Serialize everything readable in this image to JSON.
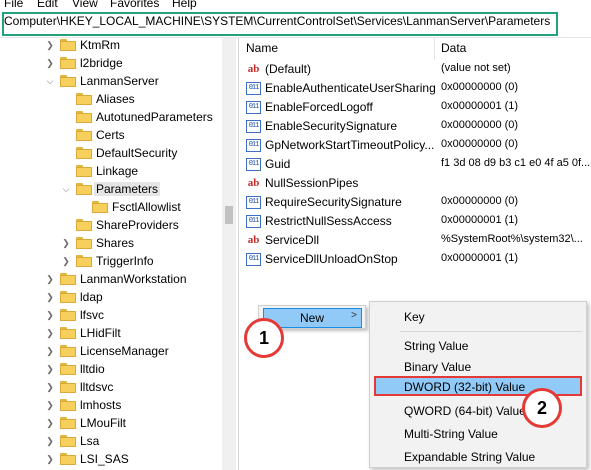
{
  "menubar": [
    "File",
    "Edit",
    "View",
    "Favorites",
    "Help"
  ],
  "address": "Computer\\HKEY_LOCAL_MACHINE\\SYSTEM\\CurrentControlSet\\Services\\LanmanServer\\Parameters",
  "accent": "#26a07a",
  "tree": [
    {
      "label": "KtmRm",
      "chevron": ">"
    },
    {
      "label": "l2bridge",
      "chevron": ">"
    },
    {
      "label": "LanmanServer",
      "chevron": "v"
    },
    {
      "label": "Aliases",
      "chevron": ""
    },
    {
      "label": "AutotunedParameters",
      "chevron": ""
    },
    {
      "label": "Certs",
      "chevron": ""
    },
    {
      "label": "DefaultSecurity",
      "chevron": ""
    },
    {
      "label": "Linkage",
      "chevron": ""
    },
    {
      "label": "Parameters",
      "chevron": "v",
      "selected": true
    },
    {
      "label": "FsctlAllowlist",
      "chevron": ""
    },
    {
      "label": "ShareProviders",
      "chevron": ""
    },
    {
      "label": "Shares",
      "chevron": ">"
    },
    {
      "label": "TriggerInfo",
      "chevron": ">"
    },
    {
      "label": "LanmanWorkstation",
      "chevron": ">"
    },
    {
      "label": "ldap",
      "chevron": ">"
    },
    {
      "label": "lfsvc",
      "chevron": ">"
    },
    {
      "label": "LHidFilt",
      "chevron": ">"
    },
    {
      "label": "LicenseManager",
      "chevron": ">"
    },
    {
      "label": "lltdio",
      "chevron": ">"
    },
    {
      "label": "lltdsvc",
      "chevron": ">"
    },
    {
      "label": "lmhosts",
      "chevron": ">"
    },
    {
      "label": "LMouFilt",
      "chevron": ">"
    },
    {
      "label": "Lsa",
      "chevron": ">"
    },
    {
      "label": "LSI_SAS",
      "chevron": ">"
    }
  ],
  "columns": {
    "name": "Name",
    "data": "Data"
  },
  "values": [
    {
      "icon": "ab",
      "name": "(Default)",
      "data": "(value not set)"
    },
    {
      "icon": "bin",
      "name": "EnableAuthenticateUserSharing",
      "data": "0x00000000 (0)"
    },
    {
      "icon": "bin",
      "name": "EnableForcedLogoff",
      "data": "0x00000001 (1)"
    },
    {
      "icon": "bin",
      "name": "EnableSecuritySignature",
      "data": "0x00000000 (0)"
    },
    {
      "icon": "bin",
      "name": "GpNetworkStartTimeoutPolicy...",
      "data": "0x00000000 (0)"
    },
    {
      "icon": "bin",
      "name": "Guid",
      "data": "f1 3d 08 d9 b3 c1 e0 4f a5 0f..."
    },
    {
      "icon": "ab",
      "name": "NullSessionPipes",
      "data": ""
    },
    {
      "icon": "bin",
      "name": "RequireSecuritySignature",
      "data": "0x00000000 (0)"
    },
    {
      "icon": "bin",
      "name": "RestrictNullSessAccess",
      "data": "0x00000001 (1)"
    },
    {
      "icon": "ab",
      "name": "ServiceDll",
      "data": "%SystemRoot%\\system32\\..."
    },
    {
      "icon": "bin",
      "name": "ServiceDllUnloadOnStop",
      "data": "0x00000001 (1)"
    }
  ],
  "context_menu": {
    "new_label": "New",
    "arrow": ">"
  },
  "submenu": {
    "key": "Key",
    "string": "String Value",
    "binary": "Binary Value",
    "dword": "DWORD (32-bit) Value",
    "qword": "QWORD (64-bit) Value",
    "multi": "Multi-String Value",
    "expand": "Expandable String Value"
  },
  "badges": {
    "one": "1",
    "two": "2"
  },
  "highlight_color": "#e53935"
}
